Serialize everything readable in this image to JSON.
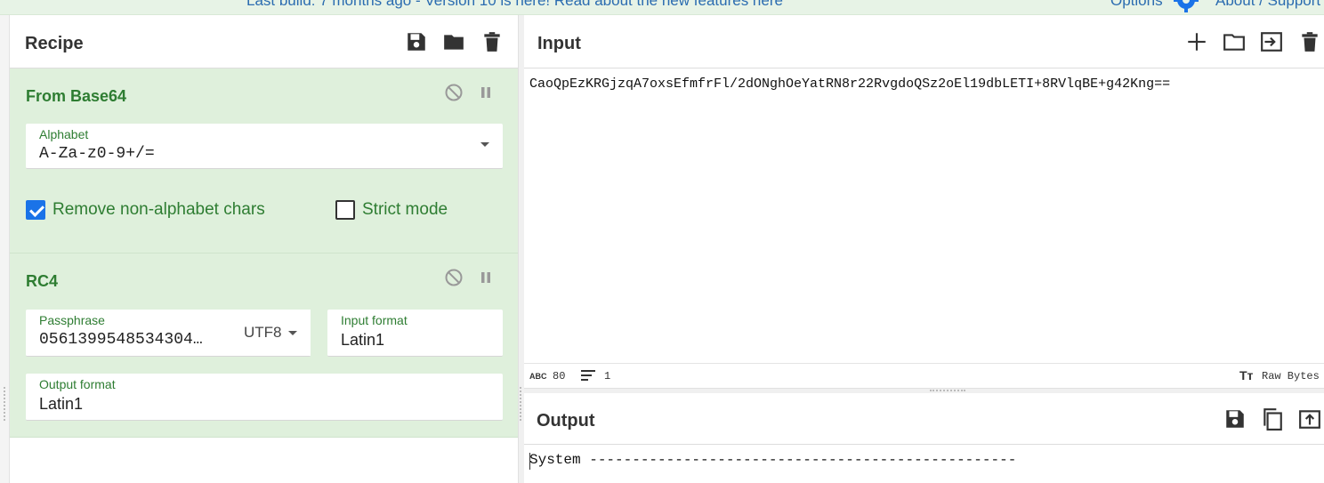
{
  "banner": {
    "message": "Last build: 7 months ago - Version 10 is here! Read about the new features here",
    "options_label": "Options",
    "about_label": "About / Support",
    "link_color": "#2b6cb0"
  },
  "recipe": {
    "title": "Recipe",
    "icons": [
      "save-icon",
      "folder-icon",
      "trash-icon"
    ],
    "operations": [
      {
        "name": "From Base64",
        "fields": {
          "alphabet_label": "Alphabet",
          "alphabet_value": "A-Za-z0-9+/="
        },
        "checkboxes": [
          {
            "label": "Remove non-alphabet chars",
            "checked": true
          },
          {
            "label": "Strict mode",
            "checked": false
          }
        ]
      },
      {
        "name": "RC4",
        "fields": {
          "passphrase_label": "Passphrase",
          "passphrase_value": "0561399548534304…",
          "passphrase_encoding": "UTF8",
          "input_format_label": "Input format",
          "input_format_value": "Latin1",
          "output_format_label": "Output format",
          "output_format_value": "Latin1"
        }
      }
    ]
  },
  "input": {
    "title": "Input",
    "text": "CaoQpEzKRGjzqA7oxsEfmfrFl/2dONghOeYatRN8r22RvgdoQSz2oEl19dbLETI+8RVlqBE+g42Kng==",
    "icons": [
      "plus-icon",
      "folder-icon",
      "import-icon",
      "trash-icon"
    ],
    "status": {
      "length": "80",
      "lines": "1",
      "format": "Raw Bytes"
    }
  },
  "output": {
    "title": "Output",
    "text": "System --------------------------------------------------",
    "icons": [
      "save-icon",
      "copy-icon",
      "replace-input-icon"
    ]
  },
  "colors": {
    "accent_green": "#2e7d32",
    "op_background": "#dff0dc",
    "checkbox_blue": "#1a73e8"
  }
}
